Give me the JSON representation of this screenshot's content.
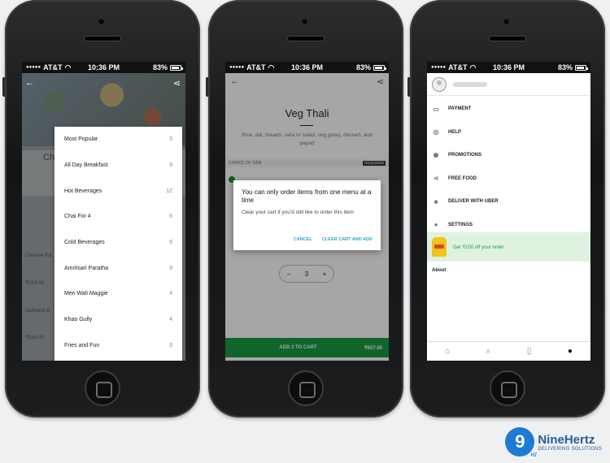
{
  "status": {
    "carrier": "AT&T",
    "time": "10:36 PM",
    "battery": "83%"
  },
  "screen1": {
    "card_title": "Ch",
    "bg_items": [
      "Cheese Pa",
      "₹114.00",
      "Gulkand B",
      "₹114.00"
    ],
    "categories": [
      {
        "label": "Most Popular",
        "count": "3"
      },
      {
        "label": "All Day Breakfast",
        "count": "9"
      },
      {
        "label": "Hot Beverages",
        "count": "12"
      },
      {
        "label": "Chai For 4",
        "count": "6"
      },
      {
        "label": "Cold Beverages",
        "count": "6"
      },
      {
        "label": "Amritsari Paratha",
        "count": "9"
      },
      {
        "label": "Meri Wali Maggie",
        "count": "4"
      },
      {
        "label": "Khao Gully",
        "count": "4"
      },
      {
        "label": "Fries and Fun",
        "count": "3"
      }
    ]
  },
  "screen2": {
    "title": "Veg Thali",
    "description": "Rice, dal, breads, raita or salad, veg gravy, dessert, and papad",
    "section_label": "CHOICE OF SIDE",
    "required": "REQUIRED",
    "dialog": {
      "title": "You can only order items from one menu at a time",
      "body": "Clear your cart if you'd still like to order this item",
      "cancel": "CANCEL",
      "confirm": "CLEAR CART AND ADD"
    },
    "quantity": "3",
    "add_label": "ADD 3 TO CART",
    "price": "₹657.00"
  },
  "screen3": {
    "menu": [
      {
        "icon": "payment-icon",
        "glyph": "▭",
        "label": "PAYMENT"
      },
      {
        "icon": "help-icon",
        "glyph": "◎",
        "label": "HELP"
      },
      {
        "icon": "promotions-icon",
        "glyph": "✺",
        "label": "PROMOTIONS"
      },
      {
        "icon": "share-icon",
        "glyph": "⋖",
        "label": "FREE FOOD"
      },
      {
        "icon": "bag-icon",
        "glyph": "■",
        "label": "DELIVER WITH UBER"
      },
      {
        "icon": "person-icon",
        "glyph": "●",
        "label": "SETTINGS"
      }
    ],
    "promo_text": "Get ₹100 off your order",
    "about": "About"
  },
  "logo": {
    "name": "NineHertz",
    "tagline": "DELIVERING SOLUTIONS",
    "mark": "9",
    "hz": "HZ"
  },
  "colors": {
    "accent_green": "#1a9b41",
    "link_teal": "#2aa8c4",
    "brand_blue": "#1e7ad6"
  }
}
